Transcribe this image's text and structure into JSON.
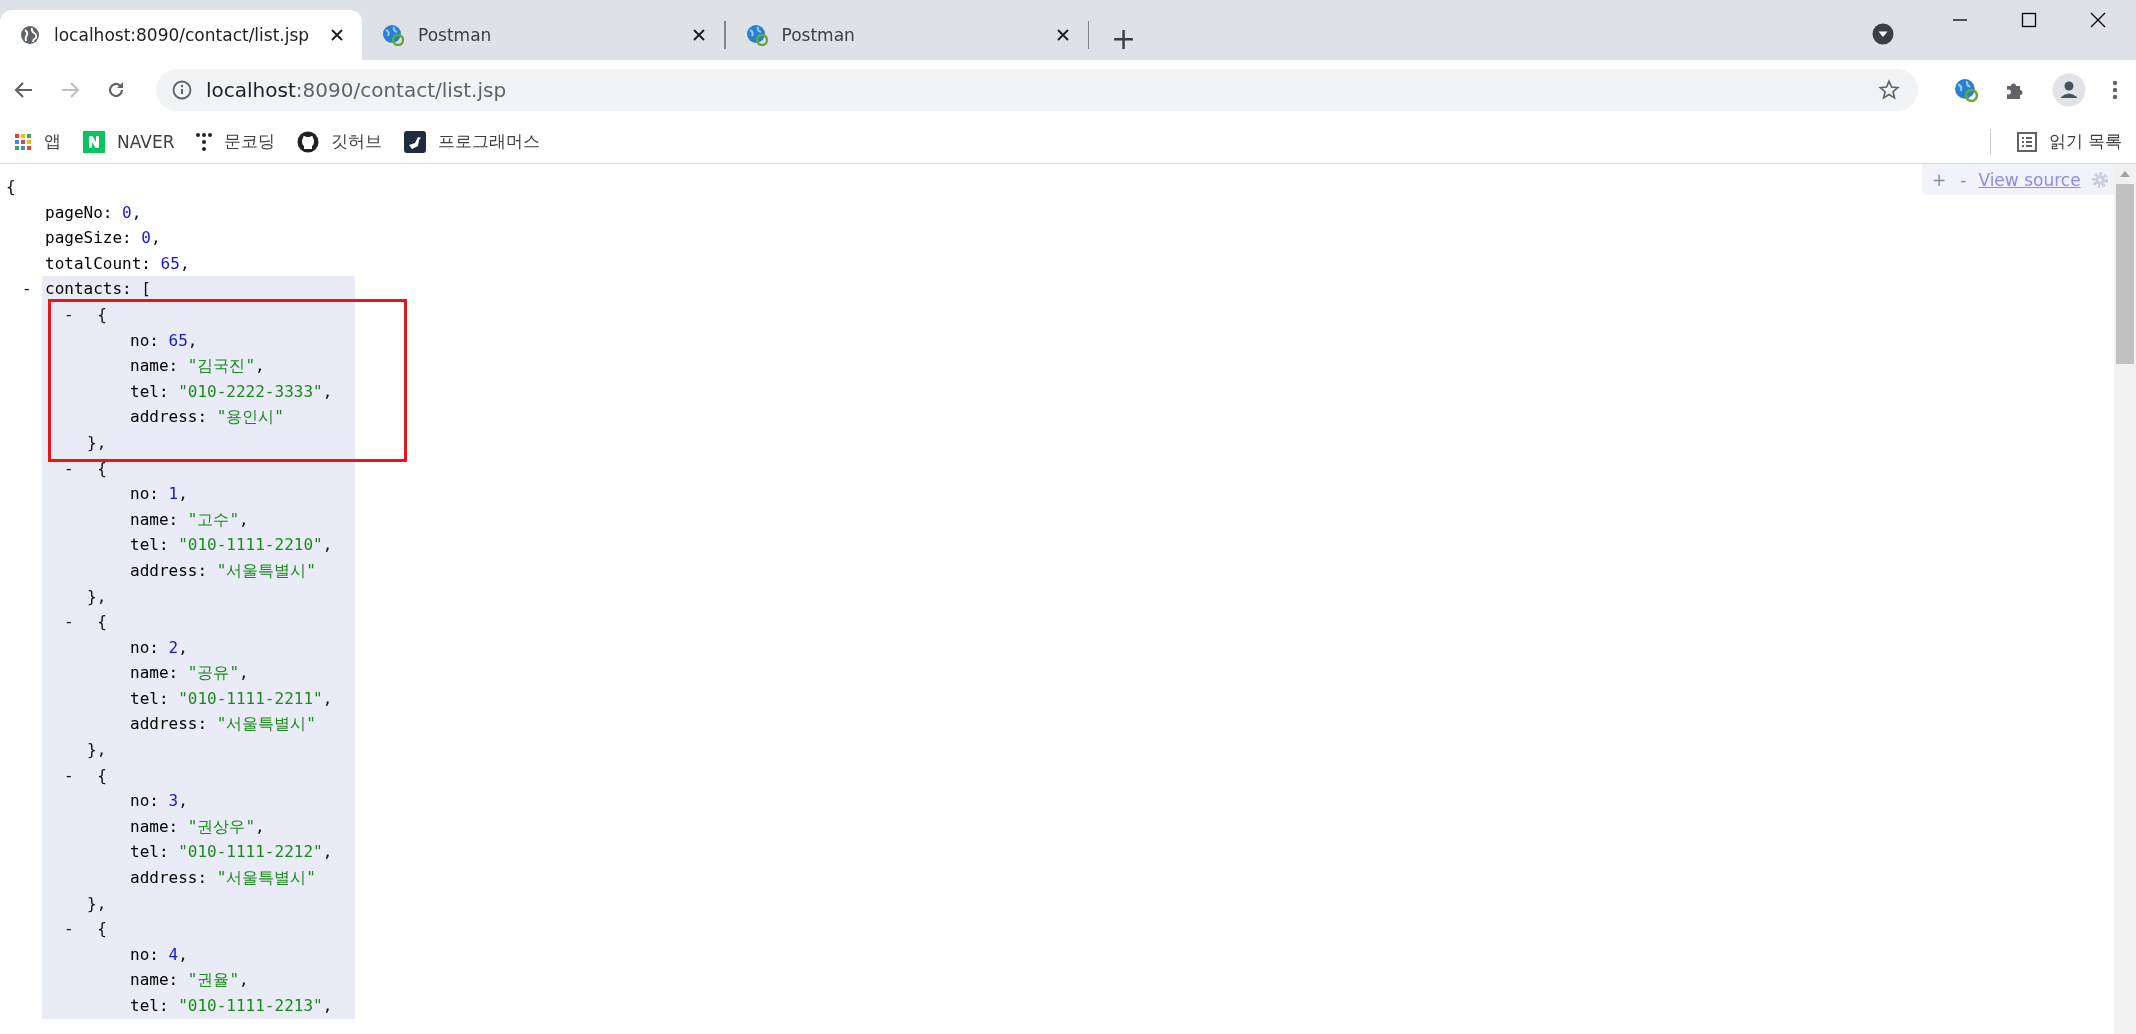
{
  "tabs": [
    {
      "title": "localhost:8090/contact/list.jsp",
      "selected": true,
      "kind": "globe"
    },
    {
      "title": "Postman",
      "selected": false,
      "kind": "extension"
    },
    {
      "title": "Postman",
      "selected": false,
      "kind": "extension"
    }
  ],
  "new_tab": "+",
  "address_bar": {
    "host": "localhost",
    "path": ":8090/contact/list.jsp"
  },
  "bookmarks": [
    {
      "label": "앱",
      "kind": "apps"
    },
    {
      "label": "NAVER",
      "kind": "naver"
    },
    {
      "label": "문코딩",
      "kind": "dots"
    },
    {
      "label": "깃허브",
      "kind": "github"
    },
    {
      "label": "프로그래머스",
      "kind": "programmers"
    }
  ],
  "reading_list": "읽기 목록",
  "viewer_toolbar": {
    "expand": "+",
    "collapse": "-",
    "view_source": "View source"
  },
  "json_view": {
    "open": "{",
    "fields": [
      {
        "key": "pageNo:",
        "value": "0",
        "trail": ",",
        "kind": "number"
      },
      {
        "key": "pageSize:",
        "value": "0",
        "trail": ",",
        "kind": "number"
      },
      {
        "key": "totalCount:",
        "value": "65",
        "trail": ",",
        "kind": "number"
      }
    ],
    "array": {
      "collapser": "-",
      "key": "contacts:",
      "open": "["
    },
    "items": [
      {
        "collapser": "-",
        "open": "{",
        "close": "},",
        "fields": [
          {
            "key": "no:",
            "value": "65",
            "trail": ",",
            "kind": "number"
          },
          {
            "key": "name:",
            "value": "\"김국진\"",
            "trail": ",",
            "kind": "string"
          },
          {
            "key": "tel:",
            "value": "\"010-2222-3333\"",
            "trail": ",",
            "kind": "string"
          },
          {
            "key": "address:",
            "value": "\"용인시\"",
            "kind": "string"
          }
        ]
      },
      {
        "collapser": "-",
        "open": "{",
        "close": "},",
        "fields": [
          {
            "key": "no:",
            "value": "1",
            "trail": ",",
            "kind": "number"
          },
          {
            "key": "name:",
            "value": "\"고수\"",
            "trail": ",",
            "kind": "string"
          },
          {
            "key": "tel:",
            "value": "\"010-1111-2210\"",
            "trail": ",",
            "kind": "string"
          },
          {
            "key": "address:",
            "value": "\"서울특별시\"",
            "kind": "string"
          }
        ]
      },
      {
        "collapser": "-",
        "open": "{",
        "close": "},",
        "fields": [
          {
            "key": "no:",
            "value": "2",
            "trail": ",",
            "kind": "number"
          },
          {
            "key": "name:",
            "value": "\"공유\"",
            "trail": ",",
            "kind": "string"
          },
          {
            "key": "tel:",
            "value": "\"010-1111-2211\"",
            "trail": ",",
            "kind": "string"
          },
          {
            "key": "address:",
            "value": "\"서울특별시\"",
            "kind": "string"
          }
        ]
      },
      {
        "collapser": "-",
        "open": "{",
        "close": "},",
        "fields": [
          {
            "key": "no:",
            "value": "3",
            "trail": ",",
            "kind": "number"
          },
          {
            "key": "name:",
            "value": "\"권상우\"",
            "trail": ",",
            "kind": "string"
          },
          {
            "key": "tel:",
            "value": "\"010-1111-2212\"",
            "trail": ",",
            "kind": "string"
          },
          {
            "key": "address:",
            "value": "\"서울특별시\"",
            "kind": "string"
          }
        ]
      },
      {
        "collapser": "-",
        "open": "{",
        "fields": [
          {
            "key": "no:",
            "value": "4",
            "trail": ",",
            "kind": "number"
          },
          {
            "key": "name:",
            "value": "\"권율\"",
            "trail": ",",
            "kind": "string"
          },
          {
            "key": "tel:",
            "value": "\"010-1111-2213\"",
            "trail": ",",
            "kind": "string"
          }
        ]
      }
    ]
  }
}
